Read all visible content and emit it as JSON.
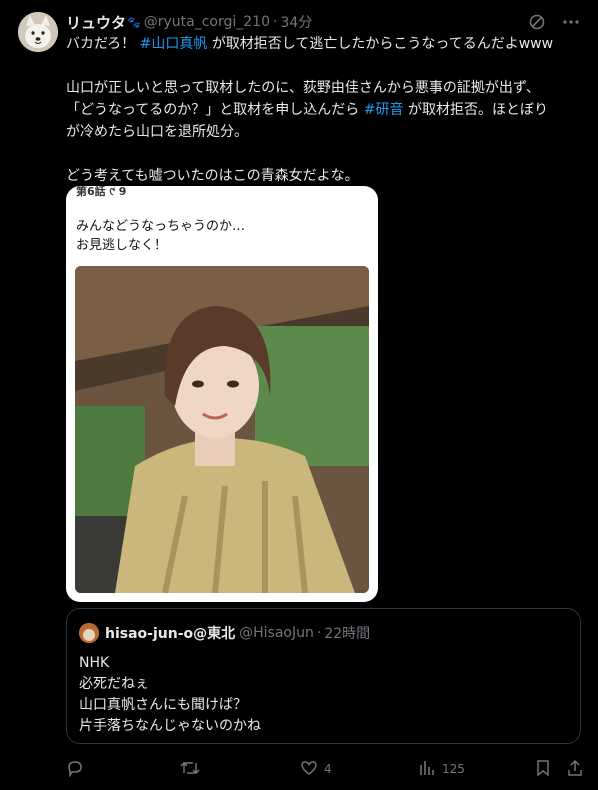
{
  "tweet": {
    "author_name": "リュウタ",
    "author_handle": "@ryuta_corgi_210",
    "separator": "·",
    "time": "34分",
    "line1_prefix": "バカだろ！",
    "line1_tag": "#山口真帆",
    "line1_suffix": "が取材拒否して逃亡したからこうなってるんだよwww",
    "para2_a": "山口が正しいと思って取材したのに、荻野由佳さんから悪事の証拠が出ず、",
    "para2_b": "「どうなってるのか？」と取材を申し込んだら",
    "para2_tag": "#研音",
    "para2_c": "が取材拒否。ほとぼり",
    "para2_d": "が冷めたら山口を退所処分。",
    "para3": "どう考えても嘘ついたのはこの青森女だよな。"
  },
  "media": {
    "top_text": "第6話 ୯ 9",
    "caption_line1": "みんなどうなっちゃうのか…",
    "caption_line2": "お見逃しなく！"
  },
  "quote": {
    "author_name": "hisao-jun-o@東北",
    "author_handle": "@HisaoJun",
    "separator": "·",
    "time": "22時間",
    "lines": [
      "NHK",
      "必死だねぇ",
      "山口真帆さんにも聞けば？",
      "片手落ちなんじゃないのかね"
    ]
  },
  "actions": {
    "likes": "4",
    "views": "125"
  },
  "icons": {
    "avatar": "corgi-avatar-icon",
    "grok": "grok-icon",
    "more": "more-icon",
    "reply": "reply-icon",
    "retweet": "retweet-icon",
    "like": "heart-icon",
    "views": "views-icon",
    "bookmark": "bookmark-icon",
    "share": "share-icon"
  },
  "colors": {
    "background": "#000000",
    "text": "#e7e9ea",
    "secondary": "#71767b",
    "link": "#1d9bf0",
    "border": "#2f3336"
  }
}
